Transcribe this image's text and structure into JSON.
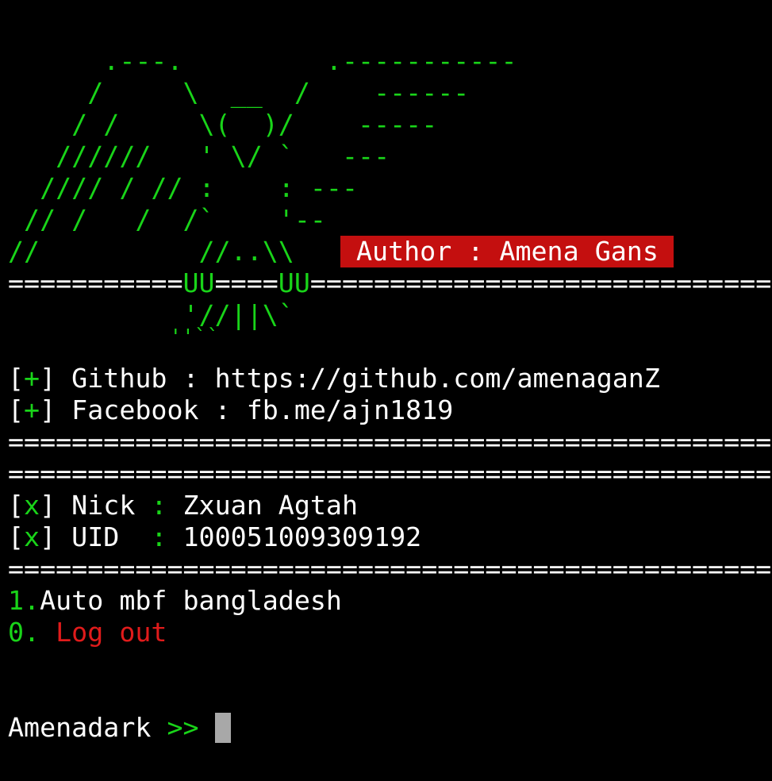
{
  "colors": {
    "background": "#000000",
    "green": "#19d419",
    "white": "#ffffff",
    "red": "#e01b1b",
    "badge_bg": "#c40f0f",
    "cursor": "#a8a8a8"
  },
  "banner": {
    "art_lines": [
      "      .---.         .-----------",
      "     /     \\  __  /    ------",
      "    / /     \\(  )/    -----",
      "   //////   ' \\/ `   ---",
      "  //// / // :    : ---",
      " // /   /  /`    '--",
      "//          //..\\\\"
    ],
    "author_label": "Author : Amena Gans",
    "separator_left": "===========",
    "separator_uu1": "UU",
    "separator_mid": "====",
    "separator_uu2": "UU",
    "separator_right": "=============================",
    "tail_1": "           '//||\\`",
    "tail_2": "             ''``"
  },
  "links": {
    "github_bracket_open": "[",
    "github_plus": "+",
    "github_bracket_close": "]",
    "github_text": " Github : https://github.com/amenaganZ",
    "facebook_bracket_open": "[",
    "facebook_plus": "+",
    "facebook_bracket_close": "]",
    "facebook_text": " Facebook : fb.me/ajn1819"
  },
  "separator": "================================================",
  "user": {
    "nick_label": " Nick ",
    "nick_colon": ":",
    "nick_value": " Zxuan Agtah",
    "uid_label": " UID  ",
    "uid_colon": ":",
    "uid_value": " 100051009309192",
    "marker": "x"
  },
  "menu": {
    "item1_number": "1.",
    "item1_label": "Auto mbf bangladesh",
    "item0_number": "0. ",
    "item0_label": "Log out"
  },
  "prompt": {
    "label": "Amenadark ",
    "arrows": ">>",
    "trailing": " "
  }
}
